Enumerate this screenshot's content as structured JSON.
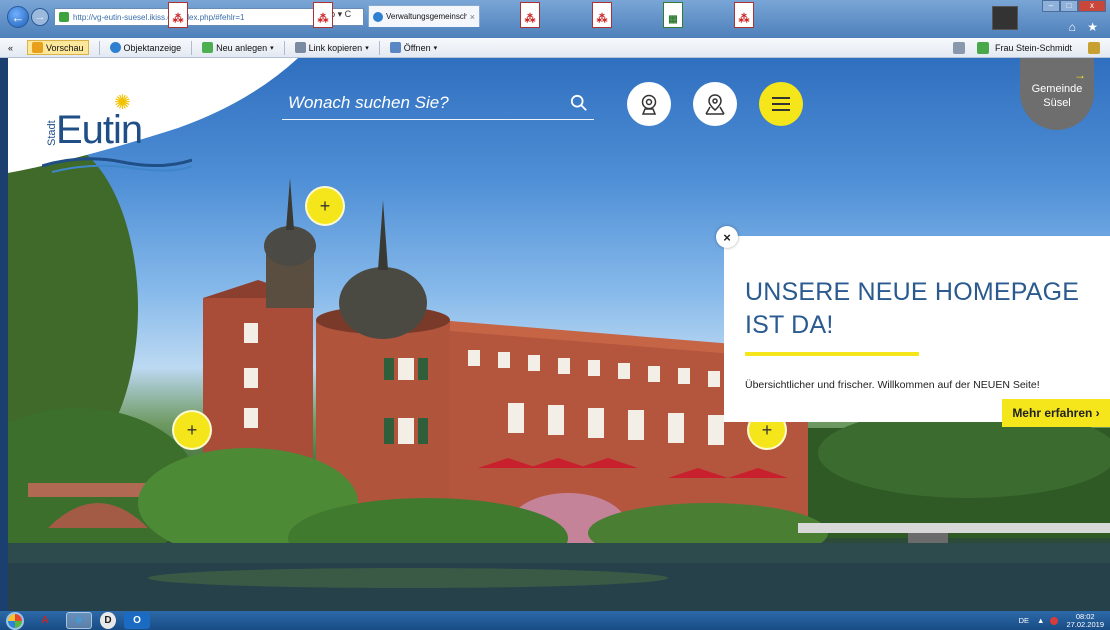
{
  "browser": {
    "url": "http://vg-eutin-suesel.ikiss.de/index.php/#fehlr=1",
    "tab_title": "Verwaltungsgemeinschaft E...",
    "tab_close": "×",
    "address_controls": "ρ ▾ C",
    "window_controls": {
      "minimize": "–",
      "maximize": "□",
      "close": "x"
    },
    "home_star": "⌂ ★"
  },
  "commandbar": {
    "items": [
      {
        "label": "Vorschau",
        "icon_color": "#e8a01c"
      },
      {
        "label": "Objektanzeige",
        "icon_color": "#2f7fd1"
      },
      {
        "label": "Neu anlegen",
        "icon_color": "#4caf50",
        "dropdown": "▾"
      },
      {
        "label": "Link kopieren",
        "icon_color": "#7a8aa0",
        "dropdown": "▾"
      },
      {
        "label": "Öffnen",
        "icon_color": "#5b86c4",
        "dropdown": "▾"
      }
    ],
    "user": "Frau Stein-Schmidt"
  },
  "site": {
    "logo_stadt": "Stadt",
    "logo_name": "Eutin",
    "search_placeholder": "Wonach suchen Sie?",
    "gemeinde_line1": "Gemeinde",
    "gemeinde_line2": "Süsel",
    "gemeinde_arrow": "→",
    "plus_symbol": "+",
    "accent_yellow": "#f5e61b"
  },
  "news": {
    "close": "×",
    "title": "UNSERE NEUE HOMEPAGE IST DA!",
    "text": "Übersichtlicher und frischer. Willkommen auf der NEUEN Seite!",
    "more": "Mehr erfahren ›"
  },
  "taskbar": {
    "apps": [
      {
        "name": "acrobat",
        "glyph": "A",
        "color": "#c8261f"
      },
      {
        "name": "internet-explorer",
        "glyph": "e",
        "color": "#39a0e6",
        "active": true
      },
      {
        "name": "dms",
        "glyph": "D",
        "color": "#1c1c1c"
      },
      {
        "name": "outlook",
        "glyph": "O",
        "color": "#1b6bc2"
      }
    ],
    "language": "DE",
    "tray_up": "▲",
    "time": "08:02",
    "date": "27.02.2019"
  }
}
